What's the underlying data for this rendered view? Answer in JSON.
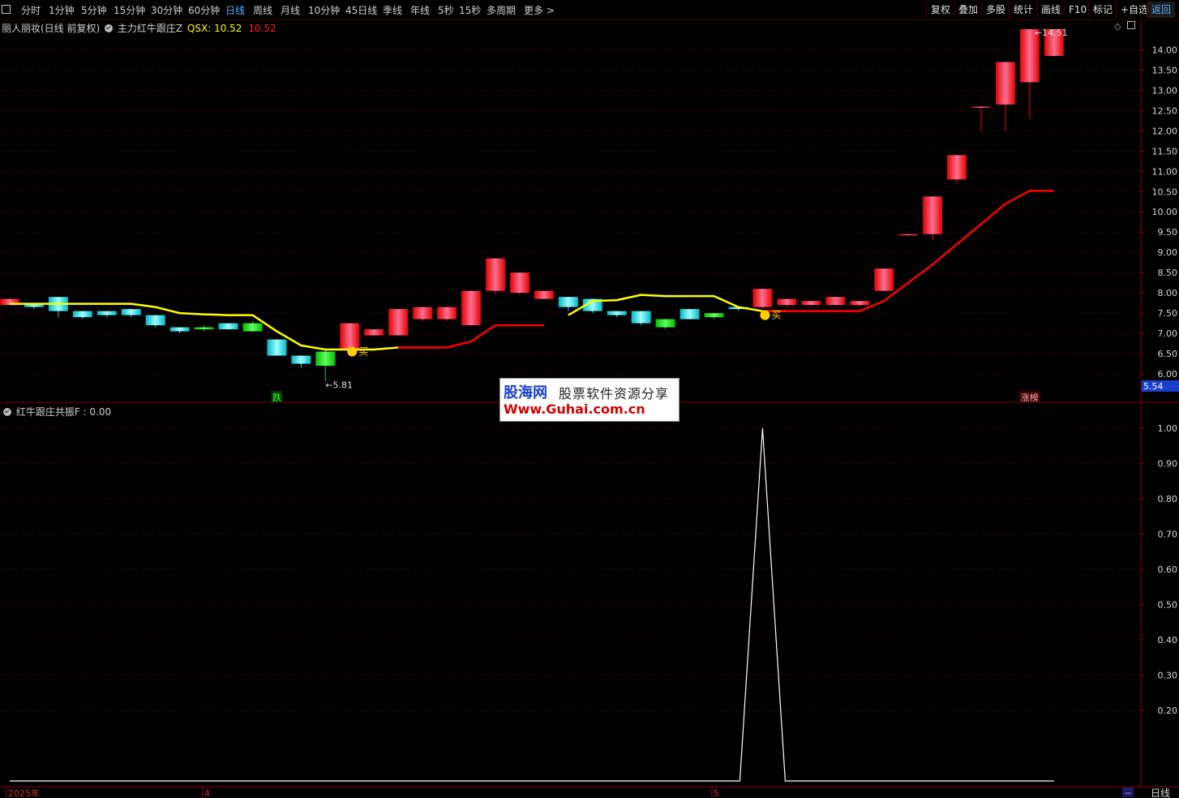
{
  "toolbar": {
    "periods": [
      "分时",
      "1分钟",
      "5分钟",
      "15分钟",
      "30分钟",
      "60分钟",
      "日线",
      "周线",
      "月线",
      "10分钟",
      "45日线",
      "季线",
      "年线",
      "5秒",
      "15秒",
      "多周期",
      "更多 >"
    ],
    "active": "日线",
    "right_buttons": [
      "复权",
      "叠加",
      "多股",
      "统计",
      "画线",
      "F10",
      "标记",
      "+自选",
      "返回"
    ]
  },
  "main_panel": {
    "stock_name": "丽人丽妆(日线 前复权)",
    "indicator_name": "主力红牛跟庄Z",
    "line_label": "QSX:",
    "line_value": "10.52",
    "value2": "10.52",
    "high_label": "14.51",
    "low_label": "5.81",
    "buy_mark": "买",
    "signal_fall": "跌",
    "signal_limit": "涨榜",
    "current_price": "5.54"
  },
  "sub_panel": {
    "indicator_name": "红牛跟庄共振F",
    "indicator_value": ": 0.00"
  },
  "watermark": {
    "logo": "股海网",
    "text": "股票软件资源分享",
    "url": "Www.Guhai.com.cn"
  },
  "bottom": {
    "date_labels": [
      "2025年",
      "4",
      "5"
    ],
    "period_label": "日线",
    "corner_label": "--"
  },
  "colors": {
    "up": "#ff0000",
    "down_cyan": "#00e0e0",
    "down_green": "#00cc00",
    "line_yellow": "#ffff00",
    "line_red": "#ff0000",
    "grid": "#6a0000"
  },
  "chart_data": [
    {
      "type": "candlestick",
      "ylim": [
        5.9,
        14.35
      ],
      "yticks": [
        6.0,
        6.5,
        7.0,
        7.5,
        8.0,
        8.5,
        9.0,
        9.5,
        10.0,
        10.5,
        11.0,
        11.5,
        12.0,
        12.5,
        13.0,
        13.5,
        14.0
      ],
      "candles": [
        {
          "o": 7.7,
          "c": 7.85,
          "h": 7.85,
          "l": 7.7,
          "t": "up"
        },
        {
          "o": 7.75,
          "c": 7.65,
          "h": 7.75,
          "l": 7.6,
          "t": "down"
        },
        {
          "o": 7.9,
          "c": 7.55,
          "h": 7.9,
          "l": 7.4,
          "t": "down"
        },
        {
          "o": 7.55,
          "c": 7.4,
          "h": 7.55,
          "l": 7.35,
          "t": "down"
        },
        {
          "o": 7.55,
          "c": 7.45,
          "h": 7.55,
          "l": 7.4,
          "t": "down"
        },
        {
          "o": 7.6,
          "c": 7.45,
          "h": 7.6,
          "l": 7.4,
          "t": "down"
        },
        {
          "o": 7.45,
          "c": 7.2,
          "h": 7.45,
          "l": 7.15,
          "t": "down"
        },
        {
          "o": 7.15,
          "c": 7.05,
          "h": 7.15,
          "l": 7.0,
          "t": "down"
        },
        {
          "o": 7.15,
          "c": 7.1,
          "h": 7.2,
          "l": 7.05,
          "t": "green"
        },
        {
          "o": 7.25,
          "c": 7.1,
          "h": 7.25,
          "l": 7.1,
          "t": "down"
        },
        {
          "o": 7.25,
          "c": 7.05,
          "h": 7.3,
          "l": 7.05,
          "t": "green"
        },
        {
          "o": 6.85,
          "c": 6.45,
          "h": 6.85,
          "l": 6.45,
          "t": "down"
        },
        {
          "o": 6.45,
          "c": 6.25,
          "h": 6.45,
          "l": 6.15,
          "t": "down"
        },
        {
          "o": 6.55,
          "c": 6.2,
          "h": 6.6,
          "l": 5.81,
          "t": "green"
        },
        {
          "o": 6.6,
          "c": 7.25,
          "h": 7.25,
          "l": 6.6,
          "t": "up"
        },
        {
          "o": 6.95,
          "c": 7.1,
          "h": 7.1,
          "l": 6.95,
          "t": "up"
        },
        {
          "o": 6.95,
          "c": 7.6,
          "h": 7.6,
          "l": 6.95,
          "t": "up"
        },
        {
          "o": 7.35,
          "c": 7.65,
          "h": 7.65,
          "l": 7.3,
          "t": "up"
        },
        {
          "o": 7.35,
          "c": 7.65,
          "h": 7.65,
          "l": 7.3,
          "t": "up"
        },
        {
          "o": 7.2,
          "c": 8.05,
          "h": 8.05,
          "l": 7.2,
          "t": "up"
        },
        {
          "o": 8.05,
          "c": 8.85,
          "h": 8.85,
          "l": 7.95,
          "t": "up"
        },
        {
          "o": 8.0,
          "c": 8.5,
          "h": 8.5,
          "l": 7.95,
          "t": "up"
        },
        {
          "o": 7.85,
          "c": 8.05,
          "h": 8.05,
          "l": 7.85,
          "t": "up"
        },
        {
          "o": 7.9,
          "c": 7.65,
          "h": 7.9,
          "l": 7.55,
          "t": "down"
        },
        {
          "o": 7.85,
          "c": 7.55,
          "h": 7.85,
          "l": 7.5,
          "t": "down"
        },
        {
          "o": 7.55,
          "c": 7.45,
          "h": 7.55,
          "l": 7.4,
          "t": "down"
        },
        {
          "o": 7.55,
          "c": 7.25,
          "h": 7.55,
          "l": 7.2,
          "t": "down"
        },
        {
          "o": 7.35,
          "c": 7.15,
          "h": 7.35,
          "l": 7.1,
          "t": "green"
        },
        {
          "o": 7.6,
          "c": 7.35,
          "h": 7.6,
          "l": 7.35,
          "t": "down"
        },
        {
          "o": 7.5,
          "c": 7.4,
          "h": 7.5,
          "l": 7.35,
          "t": "green"
        },
        {
          "o": 7.65,
          "c": 7.6,
          "h": 7.65,
          "l": 7.55,
          "t": "down"
        },
        {
          "o": 7.65,
          "c": 8.1,
          "h": 8.1,
          "l": 7.6,
          "t": "up"
        },
        {
          "o": 7.7,
          "c": 7.85,
          "h": 7.85,
          "l": 7.65,
          "t": "up"
        },
        {
          "o": 7.7,
          "c": 7.8,
          "h": 7.8,
          "l": 7.7,
          "t": "up"
        },
        {
          "o": 7.7,
          "c": 7.9,
          "h": 7.9,
          "l": 7.7,
          "t": "up"
        },
        {
          "o": 7.7,
          "c": 7.8,
          "h": 7.8,
          "l": 7.65,
          "t": "up"
        },
        {
          "o": 8.05,
          "c": 8.6,
          "h": 8.6,
          "l": 8.05,
          "t": "up"
        },
        {
          "o": 9.45,
          "c": 9.45,
          "h": 9.45,
          "l": 9.45,
          "t": "up"
        },
        {
          "o": 9.45,
          "c": 10.38,
          "h": 10.38,
          "l": 9.3,
          "t": "up"
        },
        {
          "o": 10.8,
          "c": 11.4,
          "h": 11.4,
          "l": 10.7,
          "t": "up"
        },
        {
          "o": 12.6,
          "c": 12.6,
          "h": 12.6,
          "l": 12.0,
          "t": "up"
        },
        {
          "o": 12.65,
          "c": 13.7,
          "h": 13.7,
          "l": 12.0,
          "t": "up"
        },
        {
          "o": 13.2,
          "c": 14.51,
          "h": 14.51,
          "l": 12.3,
          "t": "up"
        },
        {
          "o": 13.85,
          "c": 14.51,
          "h": 14.51,
          "l": 13.85,
          "t": "up"
        }
      ],
      "series": [
        {
          "values": [
            7.73,
            7.73,
            7.73,
            7.73,
            7.73,
            7.73,
            7.65,
            7.5,
            7.47,
            7.45,
            7.45,
            7.05,
            6.7,
            6.6,
            6.6,
            6.6,
            6.65,
            null,
            null,
            null,
            null,
            null,
            null,
            7.45,
            7.8,
            7.82,
            7.95,
            7.92,
            7.92,
            7.92,
            7.65,
            7.55,
            7.55,
            null,
            null,
            null,
            null,
            null,
            null,
            null,
            null,
            null,
            null,
            null
          ],
          "color": "#ffff00"
        },
        {
          "values": [
            null,
            null,
            null,
            null,
            null,
            null,
            null,
            null,
            null,
            null,
            null,
            null,
            null,
            null,
            null,
            null,
            6.65,
            6.65,
            6.65,
            6.8,
            7.2,
            7.2,
            7.2,
            null,
            null,
            null,
            null,
            null,
            null,
            null,
            null,
            7.55,
            7.55,
            7.55,
            7.55,
            7.55,
            7.8,
            8.25,
            8.7,
            9.2,
            9.7,
            10.2,
            10.52,
            10.52
          ],
          "color": "#ff0000"
        }
      ]
    },
    {
      "type": "line",
      "ylim": [
        0.0,
        1.03
      ],
      "yticks": [
        0.2,
        0.3,
        0.4,
        0.5,
        0.6,
        0.7,
        0.8,
        0.9,
        1.0
      ],
      "series": [
        {
          "values": [
            0,
            0,
            0,
            0,
            0,
            0,
            0,
            0,
            0,
            0,
            0,
            0,
            0,
            0,
            0,
            0,
            0,
            0,
            0,
            0,
            0,
            0,
            0,
            0,
            0,
            0,
            0,
            0,
            0,
            0,
            0,
            1,
            0,
            0,
            0,
            0,
            0,
            0,
            0,
            0,
            0,
            0,
            0,
            0
          ],
          "color": "#ffffff"
        }
      ]
    }
  ]
}
